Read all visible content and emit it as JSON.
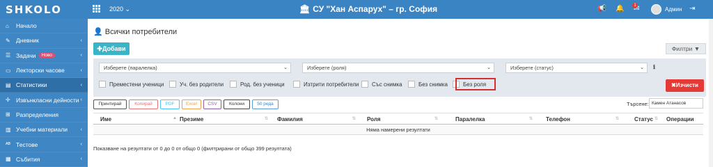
{
  "app": {
    "logo": "SHKOLO",
    "year": "2020",
    "school": "СУ \"Хан Аспарух\" – гр. София",
    "user": "Админ",
    "notification_count": "1"
  },
  "sidebar": {
    "items": [
      {
        "label": "Начало",
        "icon": "home-icon",
        "glyph": "⌂"
      },
      {
        "label": "Дневник",
        "icon": "book-icon",
        "glyph": "✎"
      },
      {
        "label": "Задачи",
        "icon": "tasks-icon",
        "glyph": "☰",
        "badge": "Ново"
      },
      {
        "label": "Лекторски часове",
        "icon": "hours-icon",
        "glyph": "▭"
      },
      {
        "label": "Статистики",
        "icon": "stats-icon",
        "glyph": "▤"
      },
      {
        "label": "Извънкласни дейности",
        "icon": "activities-icon",
        "glyph": "✢"
      },
      {
        "label": "Разпределения",
        "icon": "distribution-icon",
        "glyph": "⊞"
      },
      {
        "label": "Учебни материали",
        "icon": "materials-icon",
        "glyph": "▥"
      },
      {
        "label": "Тестове",
        "icon": "tests-icon",
        "glyph": "ᴬᴮ"
      },
      {
        "label": "Събития",
        "icon": "events-icon",
        "glyph": "▦"
      }
    ]
  },
  "main": {
    "title": "Всички потребители",
    "add_label": "Добави",
    "filters_label": "Филтри",
    "selects": {
      "class": "Изберете (паралелка)",
      "role": "Изберете (роля)",
      "status": "Изберете (статус)"
    },
    "checkboxes": [
      "Преместени ученици",
      "Уч. без родители",
      "Род. без ученици",
      "Изтрити потребители",
      "Със снимка",
      "Без снимка",
      "Без роля"
    ],
    "clear_label": "Изчисти",
    "export_buttons": [
      "Принтирай",
      "Копирай",
      "PDF",
      "Excel",
      "CSV",
      "Колони",
      "50 реда"
    ],
    "search_label": "Търсене:",
    "search_value": "Камен Атанасов",
    "columns": [
      "Име",
      "Презиме",
      "Фамилия",
      "Роля",
      "Паралелка",
      "Телефон",
      "Статус",
      "Операции"
    ],
    "empty_text": "Няма намерени резултати",
    "summary": "Показване на резултати от 0 до 0 от общо 0 (филтрирани от общо 399 резултата)"
  }
}
